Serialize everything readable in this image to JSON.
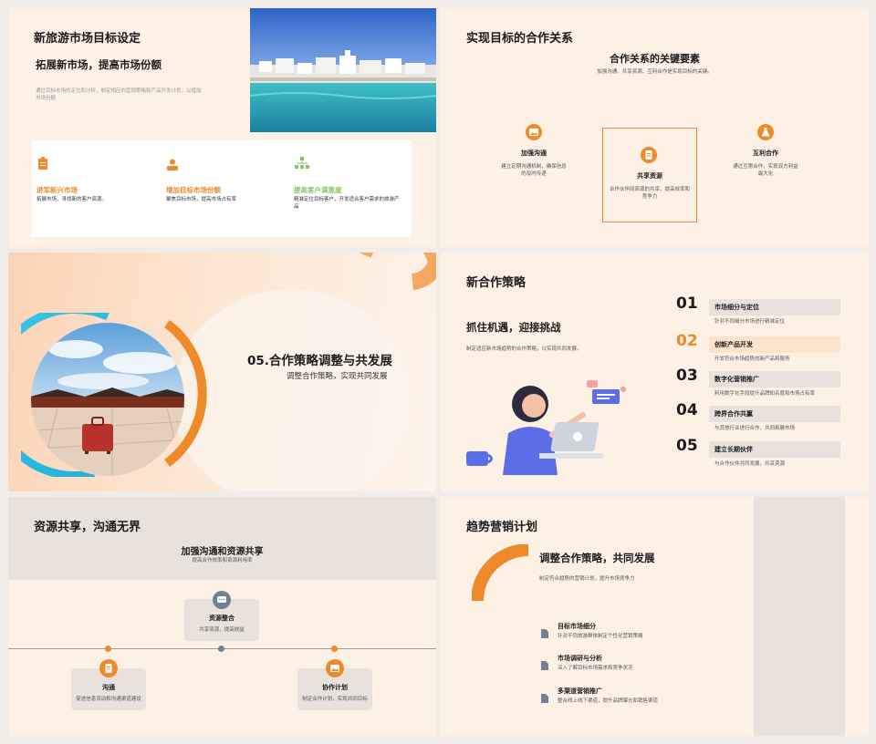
{
  "slide1": {
    "title": "新旅游市场目标设定",
    "subtitle": "拓展新市场，提高市场份额",
    "desc": "通过目标市场的定位和分析，制定相应的营销策略和产品开发计划，以增加市场份额",
    "items": [
      {
        "title": "进军新兴市场",
        "desc": "拓展市场，寻找新的客户资源。",
        "icon": "clipboard-icon"
      },
      {
        "title": "增加目标市场份额",
        "desc": "聚焦目标市场，提高市场占有率",
        "icon": "person-icon"
      },
      {
        "title": "提高客户满意度",
        "desc": "精准定位目标客户，开发适合客户需求的旅游产品",
        "icon": "hierarchy-icon"
      }
    ]
  },
  "slide2": {
    "title": "实现目标的合作关系",
    "heading": "合作关系的关键要素",
    "headdesc": "加强沟通、共享资源、互利合作是实现目标的关键。",
    "items": [
      {
        "title": "加强沟通",
        "desc": "建立定期沟通机制，确保信息的及时传递"
      },
      {
        "title": "共享资源",
        "desc": "合作伙伴间资源的共享，提高效率和竞争力"
      },
      {
        "title": "互利合作",
        "desc": "通过互惠合作，实现双方利益最大化"
      }
    ]
  },
  "slide3": {
    "title": "05.合作策略调整与共发展",
    "subtitle": "调整合作策略，实现共同发展"
  },
  "slide4": {
    "title": "新合作策略",
    "subtitle": "抓住机遇，迎接挑战",
    "desc": "制定适应新市场趋势的合作策略，以实现共同发展。",
    "items": [
      {
        "num": "01",
        "title": "市场细分与定位",
        "desc": "针对不同细分市场进行精准定位"
      },
      {
        "num": "02",
        "title": "创新产品开发",
        "desc": "开发符合市场趋势的新产品和服务"
      },
      {
        "num": "03",
        "title": "数字化营销推广",
        "desc": "利用数字化手段提升品牌知名度和市场占有率"
      },
      {
        "num": "04",
        "title": "跨界合作共赢",
        "desc": "与其他行业进行合作，共同拓展市场"
      },
      {
        "num": "05",
        "title": "建立长期伙伴",
        "desc": "与合作伙伴共同发展，共享资源"
      }
    ]
  },
  "slide5": {
    "title": "资源共享，沟通无界",
    "heading": "加强沟通和资源共享",
    "headdesc": "提高合作效率和资源利用率",
    "items": [
      {
        "title": "资源整合",
        "desc": "共享资源，提高效益"
      },
      {
        "title": "沟通",
        "desc": "促进信息流动和沟通渠道建设"
      },
      {
        "title": "协作计划",
        "desc": "制定合作计划，实现共同目标"
      }
    ]
  },
  "slide6": {
    "title": "趋势营销计划",
    "subtitle": "调整合作策略，共同发展",
    "desc": "制定符合趋势的营销计划，提升市场竞争力",
    "items": [
      {
        "title": "目标市场细分",
        "desc": "针对不同旅游群体制定个性化营销策略"
      },
      {
        "title": "市场调研与分析",
        "desc": "深入了解目标市场需求和竞争状况"
      },
      {
        "title": "多渠道营销推广",
        "desc": "整合线上线下渠道，提升品牌曝光和销售渠道"
      }
    ]
  },
  "colors": {
    "accent": "#ef8a2b",
    "green": "#8bc36a",
    "bg": "#fdf1e6",
    "gray": "#e9e2dc"
  }
}
